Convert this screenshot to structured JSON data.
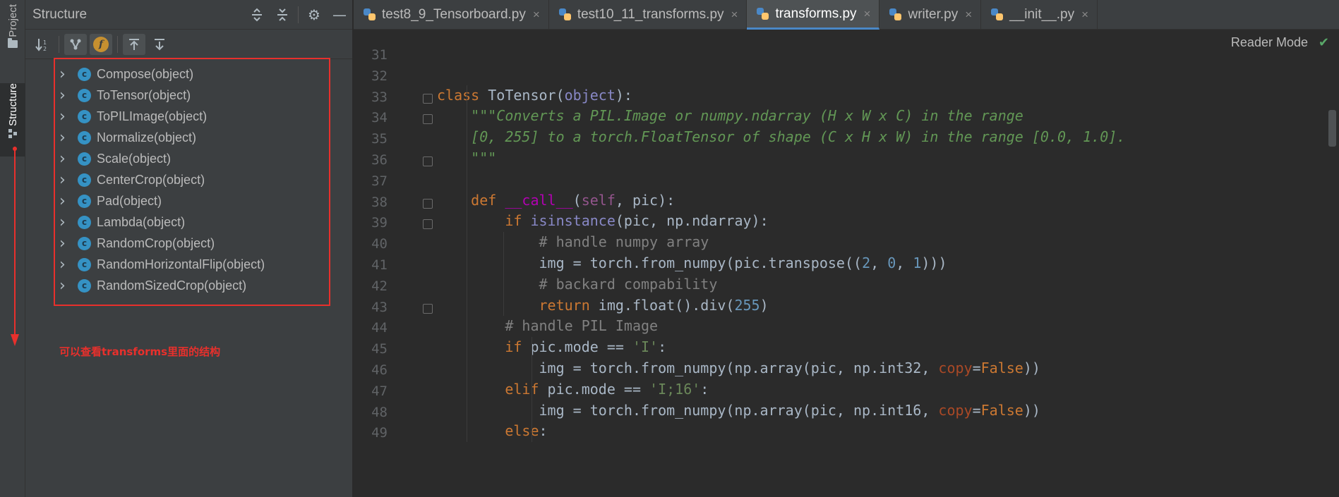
{
  "left_strip": {
    "tabs": [
      {
        "label": "Project",
        "icon": "folder-icon"
      },
      {
        "label": "Structure",
        "icon": "structure-icon"
      }
    ]
  },
  "structure_panel": {
    "title": "Structure",
    "header_buttons": [
      "expand-all-icon",
      "collapse-all-icon",
      "gear-icon",
      "minimize-icon"
    ],
    "toolbar_buttons": [
      "sort-alphabetically-icon",
      "show-inherited-icon",
      "show-fields-icon",
      "navigate-from-source-icon",
      "navigate-to-source-icon"
    ],
    "items": [
      "Compose(object)",
      "ToTensor(object)",
      "ToPILImage(object)",
      "Normalize(object)",
      "Scale(object)",
      "CenterCrop(object)",
      "Pad(object)",
      "Lambda(object)",
      "RandomCrop(object)",
      "RandomHorizontalFlip(object)",
      "RandomSizedCrop(object)"
    ],
    "class_badge": "c",
    "fields_badge": "f",
    "annotation": "可以查看transforms里面的结构",
    "annotation_color": "#e8302c"
  },
  "editor": {
    "tabs": [
      {
        "label": "test8_9_Tensorboard.py",
        "active": false
      },
      {
        "label": "test10_11_transforms.py",
        "active": false
      },
      {
        "label": "transforms.py",
        "active": true
      },
      {
        "label": "writer.py",
        "active": false
      },
      {
        "label": "__init__.py",
        "active": false
      }
    ],
    "reader_mode": "Reader Mode",
    "line_numbers": [
      "31",
      "32",
      "33",
      "34",
      "35",
      "36",
      "37",
      "38",
      "39",
      "40",
      "41",
      "42",
      "43",
      "44",
      "45",
      "46",
      "47",
      "48",
      "49"
    ],
    "colors": {
      "keyword": "#cc7832",
      "function": "#ffc66d",
      "string": "#6a8759",
      "docstring": "#629755",
      "comment": "#808080",
      "number": "#6897bb",
      "self": "#94558d",
      "dunder": "#b200b2",
      "default": "#a9b7c6"
    }
  }
}
